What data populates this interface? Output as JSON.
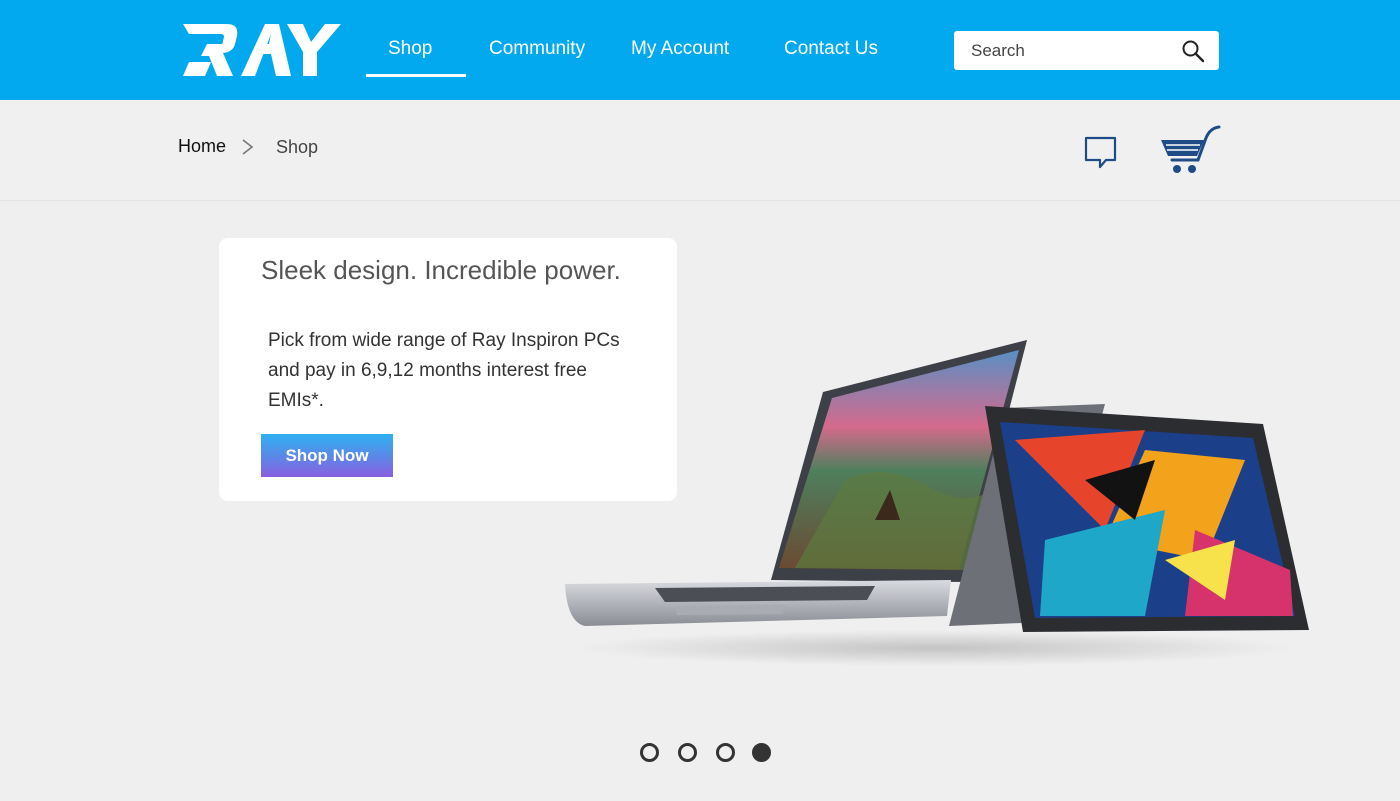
{
  "header": {
    "brand": "RAY",
    "bg_color": "#03a9ef",
    "nav": {
      "shop": "Shop",
      "community": "Community",
      "account": "My Account",
      "contact": "Contact Us"
    },
    "active_nav": "Shop",
    "search": {
      "placeholder": "Search",
      "value": ""
    }
  },
  "breadcrumb": {
    "home": "Home",
    "current": "Shop"
  },
  "icons": {
    "search": "search-icon",
    "chat": "chat-bubble-icon",
    "cart": "shopping-cart-icon",
    "breadcrumb_separator": "chevron-right-icon",
    "cart_color": "#1f4c86"
  },
  "promo": {
    "title": "Sleek design. Incredible power.",
    "description": "Pick from wide range of Ray Inspiron PCs and pay in 6,9,12 months interest free EMIs*.",
    "cta": "Shop Now"
  },
  "carousel": {
    "slides": 4,
    "active_index": 3
  }
}
